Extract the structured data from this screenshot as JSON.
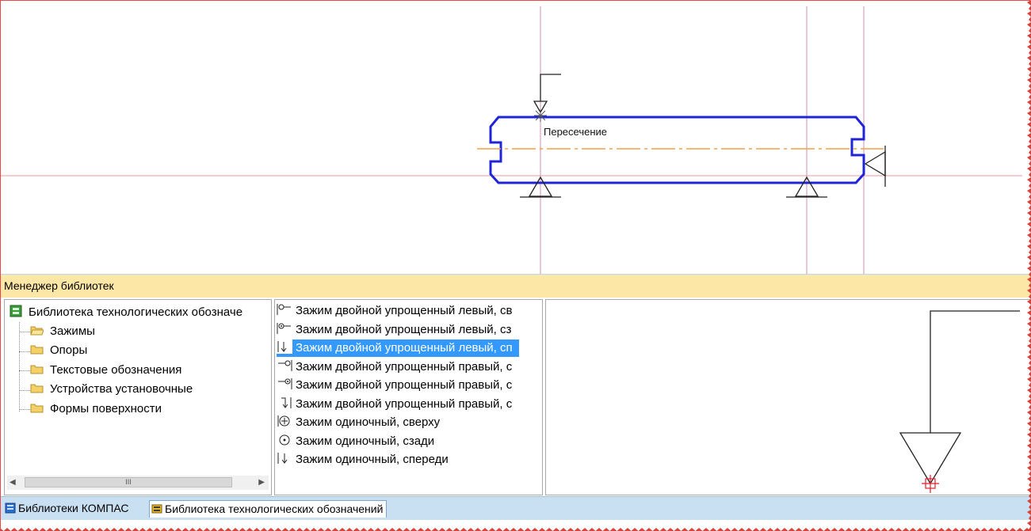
{
  "canvas": {
    "annotation_label": "Пересечение"
  },
  "library_manager": {
    "title": "Менеджер библиотек"
  },
  "tree": {
    "root_label": "Библиотека технологических обозначе",
    "items": [
      {
        "label": "Зажимы",
        "icon": "folder-open-icon"
      },
      {
        "label": "Опоры",
        "icon": "folder-icon"
      },
      {
        "label": "Текстовые обозначения",
        "icon": "folder-icon"
      },
      {
        "label": "Устройства установочные",
        "icon": "folder-icon"
      },
      {
        "label": "Формы поверхности",
        "icon": "folder-icon"
      }
    ],
    "scroll_grip": "III"
  },
  "list": {
    "items": [
      {
        "label": "Зажим двойной упрощенный левый, св",
        "icon": "clamp-double-left-icon"
      },
      {
        "label": "Зажим двойной упрощенный левый, сз",
        "icon": "clamp-double-left-icon"
      },
      {
        "label": "Зажим двойной упрощенный левый, сп",
        "icon": "clamp-double-left-front-icon",
        "selected": true
      },
      {
        "label": "Зажим двойной упрощенный правый, с",
        "icon": "clamp-double-right-icon"
      },
      {
        "label": "Зажим двойной упрощенный правый, с",
        "icon": "clamp-double-right-icon"
      },
      {
        "label": "Зажим двойной упрощенный правый, с",
        "icon": "clamp-double-right-front-icon"
      },
      {
        "label": "Зажим одиночный, сверху",
        "icon": "clamp-single-top-icon"
      },
      {
        "label": "Зажим одиночный, сзади",
        "icon": "clamp-single-back-icon"
      },
      {
        "label": "Зажим одиночный, спереди",
        "icon": "clamp-single-front-icon"
      }
    ]
  },
  "tabs": [
    {
      "label": "Библиотеки КОМПАС",
      "icon": "kompas-library-icon"
    },
    {
      "label": "Библиотека технологических обозначений",
      "icon": "tech-library-icon"
    }
  ],
  "colors": {
    "part_outline": "#1f24d6",
    "axis_line": "#f0a040",
    "guide_line": "#e89aa6",
    "selection": "#3399ff",
    "header_bg": "#fde7a6",
    "tab_bar_bg": "#c9dff2"
  }
}
